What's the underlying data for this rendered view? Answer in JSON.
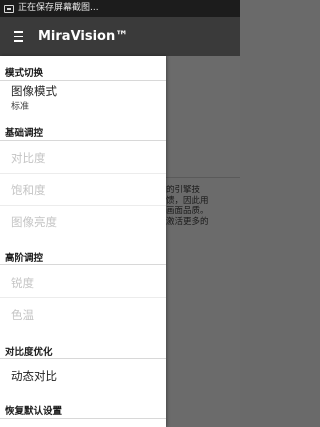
{
  "status_bar": {
    "text": "正在保存屏幕截图..."
  },
  "app_bar": {
    "title": "MiraVision™"
  },
  "background": {
    "description": "的引擎技\n馈，因此用\n画面品质。\n激活更多的"
  },
  "drawer": {
    "sections": [
      {
        "header": "模式切换",
        "items": [
          {
            "label": "图像模式",
            "sub": "标准",
            "enabled": true
          }
        ]
      },
      {
        "header": "基础调控",
        "items": [
          {
            "label": "对比度",
            "enabled": false
          },
          {
            "label": "饱和度",
            "enabled": false
          },
          {
            "label": "图像亮度",
            "enabled": false
          }
        ]
      },
      {
        "header": "高阶调控",
        "items": [
          {
            "label": "锐度",
            "enabled": false
          },
          {
            "label": "色温",
            "enabled": false
          }
        ]
      },
      {
        "header": "对比度优化",
        "items": [
          {
            "label": "动态对比",
            "enabled": true
          }
        ]
      },
      {
        "header": "恢复默认设置",
        "items": []
      }
    ]
  }
}
